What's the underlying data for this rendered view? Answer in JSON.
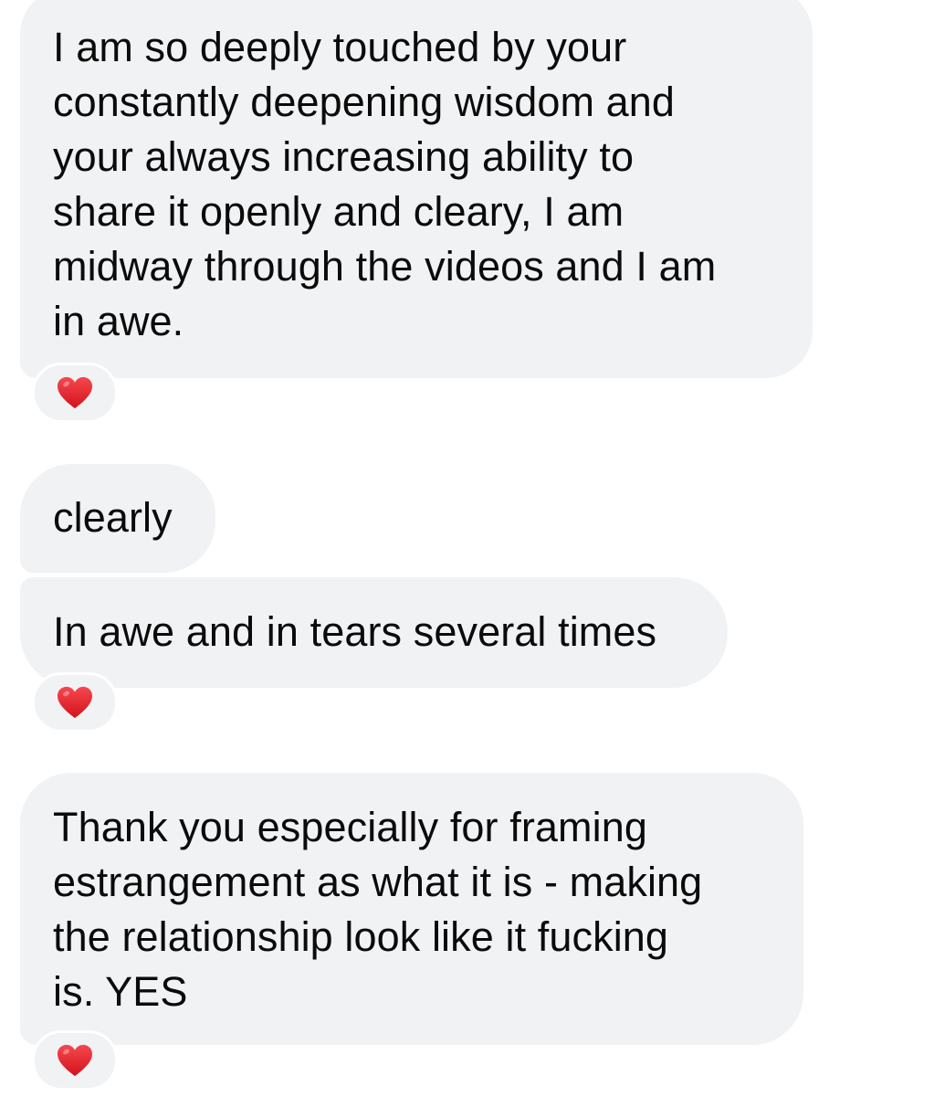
{
  "conversation": {
    "messages": [
      {
        "text": "I am so deeply touched by your\nconstantly deepening wisdom and\nyour always increasing ability to\nshare it openly and cleary, I am\nmidway through the videos and I am\nin awe.",
        "reaction": "heart-icon"
      },
      {
        "text": "clearly",
        "reaction": null
      },
      {
        "text": "In awe and in tears several times",
        "reaction": "heart-icon"
      },
      {
        "text": "Thank you especially for framing\nestrangement as what it is - making\nthe relationship look like it fucking\nis. YES",
        "reaction": "heart-icon"
      }
    ]
  },
  "colors": {
    "bubble_bg": "#f1f2f4",
    "text": "#0b0b0b",
    "heart": "#e0262e",
    "page_bg": "#ffffff"
  }
}
